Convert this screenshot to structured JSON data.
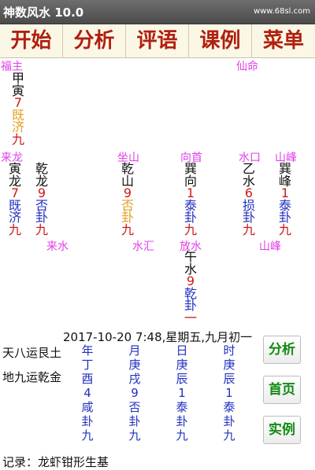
{
  "app": {
    "title": "神数风水 10.0",
    "watermark": "www.68sl.com"
  },
  "menu": [
    "开始",
    "分析",
    "评语",
    "课例",
    "菜单"
  ],
  "labels": {
    "fuzhu": "福主",
    "xianming": "仙命",
    "lailong": "来龙",
    "zuoshan": "坐山",
    "xiangshou": "向首",
    "shuikou": "水口",
    "shanfeng_top": "山峰",
    "laishui": "来水",
    "shuihui": "水汇",
    "fangshui": "放水",
    "shanfeng_bottom": "山峰"
  },
  "columns": {
    "fuzhu": [
      "甲",
      "寅",
      "7",
      "既",
      "济",
      "九"
    ],
    "lailong": [
      "寅",
      "龙",
      "7",
      "既",
      "济",
      "九"
    ],
    "qianlong": [
      "乾",
      "龙",
      "9",
      "否",
      "卦",
      "九"
    ],
    "zuoshan": [
      "乾",
      "山",
      "9",
      "否",
      "卦",
      "九"
    ],
    "xiangshou": [
      "巽",
      "向",
      "1",
      "泰",
      "卦",
      "九"
    ],
    "shuikou": [
      "乙",
      "水",
      "6",
      "损",
      "卦",
      "九"
    ],
    "shanfeng": [
      "巽",
      "峰",
      "1",
      "泰",
      "卦",
      "九"
    ],
    "fangshui": [
      "午",
      "水",
      "9",
      "乾",
      "卦",
      "一"
    ]
  },
  "datetime": "2017-10-20 7:48,星期五,九月初一",
  "yun": [
    "天八运艮土",
    "地九运乾金"
  ],
  "pillars": [
    [
      "年",
      "丁",
      "酉",
      "4",
      "咸",
      "卦",
      "九"
    ],
    [
      "月",
      "庚",
      "戌",
      "9",
      "否",
      "卦",
      "九"
    ],
    [
      "日",
      "庚",
      "辰",
      "1",
      "泰",
      "卦",
      "九"
    ],
    [
      "时",
      "庚",
      "辰",
      "1",
      "泰",
      "卦",
      "九"
    ]
  ],
  "buttons": {
    "analyze": "分析",
    "home": "首页",
    "example": "实例"
  },
  "record": "记录：龙虾钳形生基"
}
